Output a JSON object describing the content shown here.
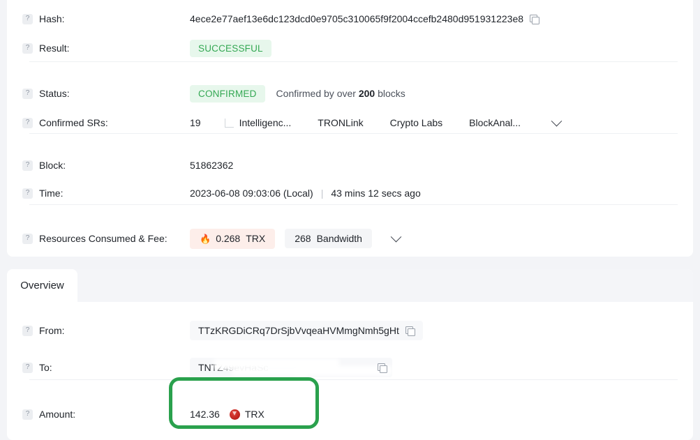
{
  "detail": {
    "hash": {
      "label": "Hash:",
      "value": "4ece2e77aef13e6dc123dcd0e9705c310065f9f2004ccefb2480d951931223e8",
      "copy_icon": "copy-icon",
      "help_icon": "?"
    },
    "result": {
      "label": "Result:",
      "value": "SUCCESSFUL",
      "help_icon": "?"
    },
    "status": {
      "label": "Status:",
      "badge": "CONFIRMED",
      "note_prefix": "Confirmed by over ",
      "note_count": "200",
      "note_suffix": " blocks",
      "help_icon": "?"
    },
    "confirmed_srs": {
      "label": "Confirmed SRs:",
      "count": "19",
      "items": [
        "Intelligenc...",
        "TRONLink",
        "Crypto Labs",
        "BlockAnal..."
      ],
      "expand_icon": "chevron-down-icon",
      "help_icon": "?"
    },
    "block": {
      "label": "Block:",
      "value": "51862362",
      "help_icon": "?"
    },
    "time": {
      "label": "Time:",
      "value": "2023-06-08 09:03:06 (Local)",
      "separator": "|",
      "relative": "43 mins 12 secs ago",
      "help_icon": "?"
    },
    "resources": {
      "label": "Resources Consumed & Fee:",
      "fee_icon": "🔥",
      "fee_amount": "0.268",
      "fee_unit": "TRX",
      "bandwidth_amount": "268",
      "bandwidth_unit": "Bandwidth",
      "expand_icon": "chevron-down-icon",
      "help_icon": "?"
    }
  },
  "overview": {
    "tab_label": "Overview",
    "from": {
      "label": "From:",
      "value": "TTzKRGDiCRq7DrSjbVvqeaHVMmgNmh5gHt",
      "copy_icon": "copy-icon",
      "help_icon": "?"
    },
    "to": {
      "label": "To:",
      "value_visible_start": "TNTZ",
      "value_obscured_mid": "49evHaSc",
      "copy_icon": "copy-icon",
      "help_icon": "?"
    },
    "amount": {
      "label": "Amount:",
      "value": "142.36",
      "token_icon": "trx-token-icon",
      "token_symbol": "TRX",
      "help_icon": "?"
    }
  },
  "annotation": {
    "color": "#2aa14d",
    "shape": "rounded-rect-highlight"
  }
}
